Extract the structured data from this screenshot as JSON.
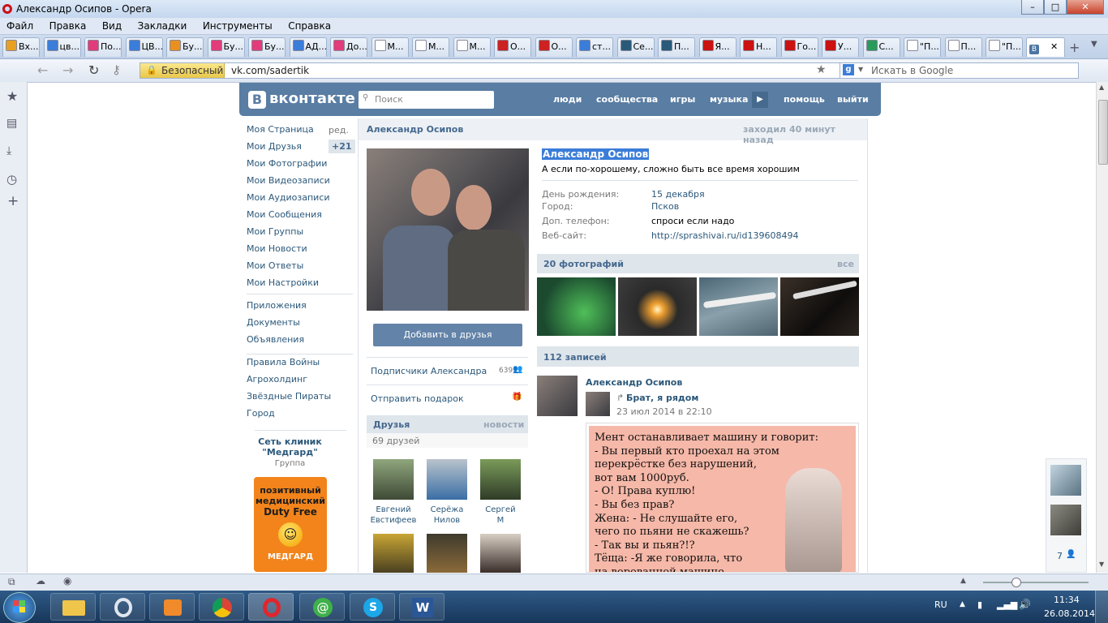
{
  "window": {
    "title": "Александр Осипов - Opera"
  },
  "menu": [
    "Файл",
    "Правка",
    "Вид",
    "Закладки",
    "Инструменты",
    "Справка"
  ],
  "tabs": [
    "Вх...",
    "цв...",
    "По...",
    "ЦВ...",
    "Бу...",
    "Бу...",
    "Бу...",
    "АД...",
    "До...",
    "М...",
    "М...",
    "М...",
    "О...",
    "О...",
    "ст...",
    "Се...",
    "П...",
    "Я...",
    "Н...",
    "Го...",
    "У...",
    "С...",
    "\"П...",
    "П...",
    "\"П..."
  ],
  "address": {
    "security_label": "Безопасный",
    "url": "vk.com/sadertik",
    "search_placeholder": "Искать в Google"
  },
  "vk": {
    "logo": "вконтакте",
    "search_placeholder": "Поиск",
    "nav": [
      "люди",
      "сообщества",
      "игры",
      "музыка",
      "помощь",
      "выйти"
    ],
    "left_menu": [
      "Моя Страница",
      "Мои Друзья",
      "Мои Фотографии",
      "Мои Видеозаписи",
      "Мои Аудиозаписи",
      "Мои Сообщения",
      "Мои Группы",
      "Мои Новости",
      "Мои Ответы",
      "Мои Настройки"
    ],
    "edit_label": "ред.",
    "friends_badge": "+21",
    "left_menu2": [
      "Приложения",
      "Документы",
      "Объявления"
    ],
    "left_menu3": [
      "Правила Войны",
      "Агрохолдинг",
      "Звёздные Пираты",
      "Город"
    ],
    "ad": {
      "title": "Сеть клиник \"Медгард\"",
      "subtitle": "Группа",
      "line1": "позитивный",
      "line2": "медицинский",
      "line3": "Duty Free",
      "brand": "МЕДГАРД"
    },
    "profile": {
      "header_name": "Александр Осипов",
      "last_seen": "заходил 40 минут назад",
      "name": "Александр Осипов",
      "status": "А если по-хорошему, сложно быть все время хорошим",
      "info": [
        {
          "label": "День рождения:",
          "value": "15 декабря"
        },
        {
          "label": "Город:",
          "value": "Псков"
        },
        {
          "label": "Доп. телефон:",
          "value": "спроси если надо"
        },
        {
          "label": "Веб-сайт:",
          "value": "http://sprashivai.ru/id139608494"
        }
      ],
      "add_friend": "Добавить в друзья",
      "subscribers": "Подписчики Александра",
      "subscribers_count": "639",
      "gift": "Отправить подарок",
      "friends_title": "Друзья",
      "friends_news": "новости",
      "friends_count": "69 друзей",
      "friends": [
        {
          "first": "Евгений",
          "last": "Евстифеев"
        },
        {
          "first": "Серёжа",
          "last": "Нилов"
        },
        {
          "first": "Сергей",
          "last": "М"
        }
      ],
      "photos_title": "20 фотографий",
      "photos_all": "все",
      "posts_title": "112 записей",
      "post_author": "Александр Осипов",
      "post_repost": "Брат, я рядом",
      "post_date": "23 июл 2014 в 22:10",
      "post_text": [
        "Мент останавливает машину и говорит:",
        "- Вы первый кто проехал на этом",
        "перекрёстке без нарушений,",
        "вот вам 1000руб.",
        "- О! Права куплю!",
        "- Вы без прав?",
        "Жена: - Не слушайте его,",
        "чего по пьяни не скажешь?",
        "- Так вы и пьян?!?",
        "Тёща: -Я же говорила, что",
        "на ворованной машине"
      ],
      "online_count": "7"
    }
  },
  "taskbar": {
    "lang": "RU",
    "time": "11:34",
    "date": "26.08.2014"
  }
}
